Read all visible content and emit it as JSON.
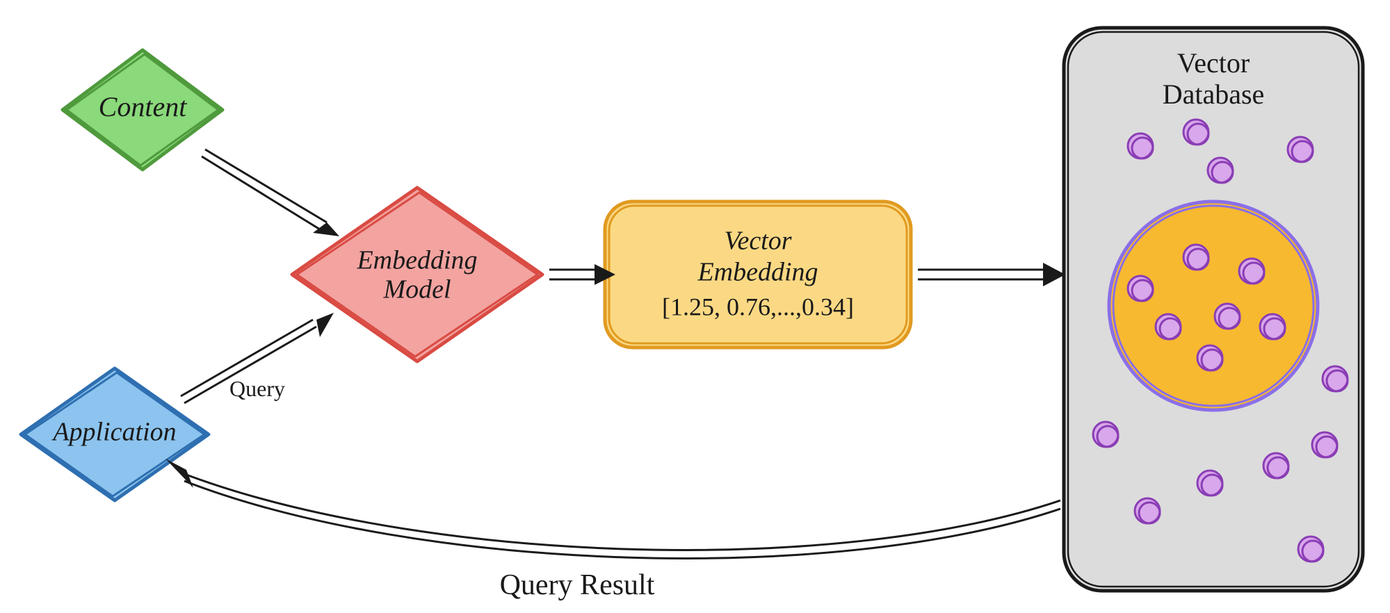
{
  "nodes": {
    "content": {
      "label": "Content"
    },
    "application": {
      "label": "Application"
    },
    "embedding_model": {
      "label_line1": "Embedding",
      "label_line2": "Model"
    },
    "vector_embedding": {
      "label_line1": "Vector",
      "label_line2": "Embedding",
      "label_line3": "[1.25, 0.76,...,0.34]"
    },
    "vector_database": {
      "label_line1": "Vector",
      "label_line2": "Database"
    }
  },
  "edges": {
    "query": {
      "label": "Query"
    },
    "query_result": {
      "label": "Query Result"
    }
  },
  "colors": {
    "content_fill": "#8ad97a",
    "content_stroke": "#4f9a3d",
    "application_fill": "#8cc4ef",
    "application_stroke": "#2e6fb1",
    "embedding_fill": "#f3a3a0",
    "embedding_stroke": "#d94b43",
    "vector_fill": "#fbd984",
    "vector_stroke": "#e19a20",
    "db_fill": "#dcdcdc",
    "db_stroke": "#1a1a1a",
    "cluster_fill": "#f7b92f",
    "cluster_stroke": "#8a6fe8",
    "point_fill": "#d9a7eb",
    "point_stroke": "#8a3db5"
  }
}
